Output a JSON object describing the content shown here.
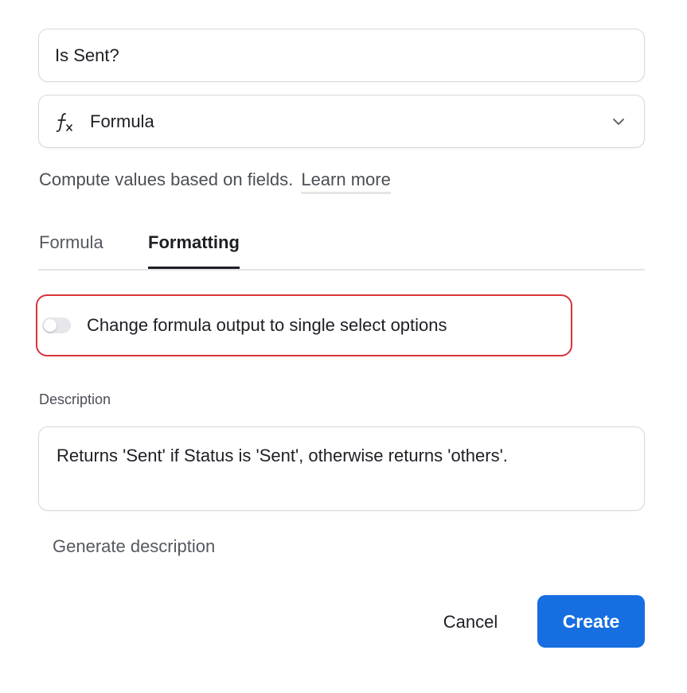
{
  "field_name": {
    "value": "Is Sent?"
  },
  "field_type": {
    "icon": "formula-fx-icon",
    "label": "Formula",
    "dropdown_icon": "chevron-down-icon"
  },
  "help": {
    "text": "Compute values based on fields.",
    "link": "Learn more"
  },
  "tabs": [
    {
      "label": "Formula",
      "active": false
    },
    {
      "label": "Formatting",
      "active": true
    }
  ],
  "toggle": {
    "label": "Change formula output to single select options",
    "enabled": false,
    "highlight_color": "#d8343b"
  },
  "description": {
    "label": "Description",
    "value": "Returns 'Sent' if Status is 'Sent', otherwise returns 'others'.",
    "generate_label": "Generate description"
  },
  "actions": {
    "cancel_label": "Cancel",
    "create_label": "Create",
    "create_color": "#166ee1"
  }
}
